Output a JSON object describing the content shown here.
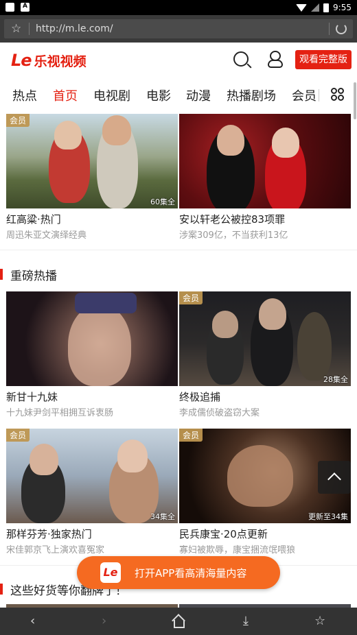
{
  "status_bar": {
    "time": "9:55"
  },
  "browser": {
    "url": "http://m.le.com/"
  },
  "header": {
    "logo_mark": "Le",
    "logo_text": "乐视视频",
    "full_version_label": "观看完整版"
  },
  "nav": {
    "tabs": [
      {
        "label": "热点"
      },
      {
        "label": "首页"
      },
      {
        "label": "电视剧"
      },
      {
        "label": "电影"
      },
      {
        "label": "动漫"
      },
      {
        "label": "热播剧场"
      },
      {
        "label": "会员"
      }
    ],
    "active": "首页"
  },
  "top_cards": [
    {
      "title": "红高粱·热门",
      "subtitle": "周迅朱亚文演绎经典",
      "vip": "会员",
      "episodes": "60集全"
    },
    {
      "title": "安以轩老公被控83项罪",
      "subtitle": "涉案309亿，不当获利13亿",
      "vip": "",
      "episodes": ""
    }
  ],
  "section1": {
    "title": "重磅热播",
    "cards": [
      {
        "title": "新甘十九妹",
        "subtitle": "十九妹尹剑平相拥互诉衷肠",
        "vip": "",
        "episodes": ""
      },
      {
        "title": "终极追捕",
        "subtitle": "李成儒侦破盗窃大案",
        "vip": "会员",
        "episodes": "28集全"
      },
      {
        "title": "那样芬芳·独家热门",
        "subtitle": "宋佳郭京飞上演欢喜冤家",
        "vip": "会员",
        "episodes": "34集全"
      },
      {
        "title": "民兵康宝·20点更新",
        "subtitle": "寡妇被欺辱，康宝捆流氓喂狼",
        "vip": "会员",
        "episodes": "更新至34集"
      }
    ]
  },
  "section2": {
    "title": "这些好货等你翻牌了！"
  },
  "open_app": {
    "logo": "Le",
    "label": "打开APP看高清海量内容"
  },
  "colors": {
    "brand": "#e42112",
    "promo": "#f56a21",
    "vip_badge": "#be9650"
  }
}
